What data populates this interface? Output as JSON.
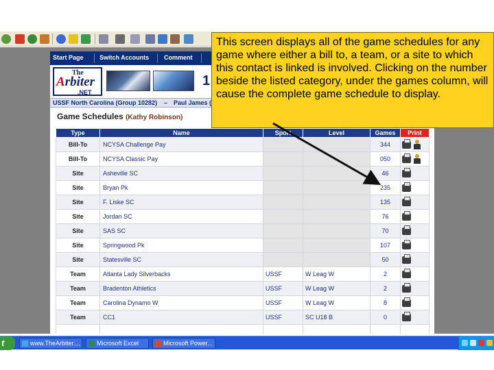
{
  "site": {
    "nav": [
      "Start Page",
      "Switch Accounts",
      "Comment"
    ],
    "logo": {
      "line1": "The",
      "line2_accent": "A",
      "line2_rest": "rbiter",
      "line3": ".NET"
    },
    "banner_fragment": "1",
    "group_bar": "USSF North Carolina (Group 10282)",
    "group_dash": "–",
    "group_user": "Paul James (",
    "title": "Game Schedules",
    "contact": "(Kathy Robinson)"
  },
  "table": {
    "headers": {
      "type": "Type",
      "name": "Name",
      "sport": "Sport",
      "level": "Level",
      "games": "Games",
      "print": "Print"
    },
    "rows": [
      {
        "type": "Bill-To",
        "name": "NCYSA Challenge Pay",
        "sport": "",
        "level": "",
        "games": "344",
        "ref": true
      },
      {
        "type": "Bill-To",
        "name": "NCYSA Classic Pay",
        "sport": "",
        "level": "",
        "games": "050",
        "ref": true
      },
      {
        "type": "Site",
        "name": "Asheville SC",
        "sport": "",
        "level": "",
        "games": "46",
        "ref": false
      },
      {
        "type": "Site",
        "name": "Bryan Pk",
        "sport": "",
        "level": "",
        "games": "235",
        "ref": false
      },
      {
        "type": "Site",
        "name": "F. Liske SC",
        "sport": "",
        "level": "",
        "games": "135",
        "ref": false
      },
      {
        "type": "Site",
        "name": "Jordan SC",
        "sport": "",
        "level": "",
        "games": "76",
        "ref": false
      },
      {
        "type": "Site",
        "name": "SAS SC",
        "sport": "",
        "level": "",
        "games": "70",
        "ref": false
      },
      {
        "type": "Site",
        "name": "Springwood Pk",
        "sport": "",
        "level": "",
        "games": "107",
        "ref": false
      },
      {
        "type": "Site",
        "name": "Statesville SC",
        "sport": "",
        "level": "",
        "games": "50",
        "ref": false
      },
      {
        "type": "Team",
        "name": "Atlanta Lady Silverbacks",
        "sport": "USSF",
        "level": "W Leag W",
        "games": "2",
        "ref": false
      },
      {
        "type": "Team",
        "name": "Bradenton Athletics",
        "sport": "USSF",
        "level": "W Leag W",
        "games": "2",
        "ref": false
      },
      {
        "type": "Team",
        "name": "Carolina Dynamo W",
        "sport": "USSF",
        "level": "W Leag W",
        "games": "8",
        "ref": false
      },
      {
        "type": "Team",
        "name": "CC1",
        "sport": "USSF",
        "level": "SC U18 B",
        "games": "0",
        "ref": false
      },
      {
        "type": "",
        "name": "",
        "sport": "",
        "level": "",
        "games": "",
        "ref": false
      }
    ]
  },
  "callout": {
    "text": "This screen displays all of the game schedules for any game where either a bill to, a team, or a site to which this contact is linked is involved.  Clicking on the number beside the listed category, under the games column, will cause the complete game schedule to display."
  },
  "taskbar": {
    "start": "t",
    "tasks": [
      {
        "label": "www.TheArbiter....",
        "icon_color": "#4aa3f0"
      },
      {
        "label": "Microsoft Excel",
        "icon_color": "#2e8b3e"
      },
      {
        "label": "Microsoft Power...",
        "icon_color": "#d84a1b"
      }
    ]
  },
  "colors": {
    "nav_bg": "#0d2d7a",
    "header_bg": "#1d3b87",
    "print_header_bg": "#d8271f",
    "callout_bg": "#ffd21f",
    "taskbar_bg": "#2456d8"
  }
}
